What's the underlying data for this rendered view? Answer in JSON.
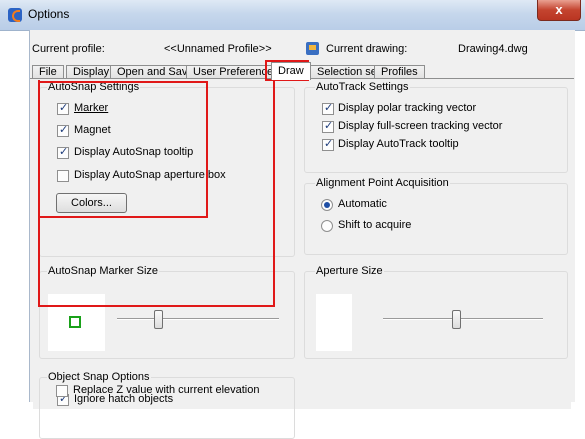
{
  "window": {
    "title": "Options",
    "close_glyph": "x"
  },
  "header": {
    "current_profile_label": "Current profile:",
    "current_profile_value": "<<Unnamed Profile>>",
    "current_drawing_label": "Current drawing:",
    "current_drawing_value": "Drawing4.dwg"
  },
  "tabs": [
    {
      "label": "File"
    },
    {
      "label": "Display"
    },
    {
      "label": "Open and Save"
    },
    {
      "label": "User Preferences"
    },
    {
      "label": "Draw",
      "active": true
    },
    {
      "label": "Selection set"
    },
    {
      "label": "Profiles"
    }
  ],
  "autosnap": {
    "title": "AutoSnap Settings",
    "items": [
      {
        "label": "Marker",
        "checked": true
      },
      {
        "label": "Magnet",
        "checked": true
      },
      {
        "label": "Display AutoSnap tooltip",
        "checked": true
      },
      {
        "label": "Display AutoSnap aperture box",
        "checked": false
      }
    ],
    "colors_button": "Colors..."
  },
  "autotrack": {
    "title": "AutoTrack Settings",
    "items": [
      {
        "label": "Display polar tracking vector",
        "checked": true
      },
      {
        "label": "Display full-screen tracking vector",
        "checked": true
      },
      {
        "label": "Display AutoTrack tooltip",
        "checked": true
      }
    ]
  },
  "alignment": {
    "title": "Alignment Point Acquisition",
    "options": [
      {
        "label": "Automatic",
        "selected": true
      },
      {
        "label": "Shift to acquire",
        "selected": false
      }
    ]
  },
  "marker_size": {
    "title": "AutoSnap Marker Size",
    "marker_color": "#1aa11a"
  },
  "aperture_size": {
    "title": "Aperture Size"
  },
  "object_snap": {
    "title": "Object Snap Options",
    "items": [
      {
        "label": "Ignore hatch objects",
        "checked": true
      },
      {
        "label": "Replace Z value with current elevation",
        "checked": false
      }
    ]
  },
  "highlight_color": "#e01818"
}
